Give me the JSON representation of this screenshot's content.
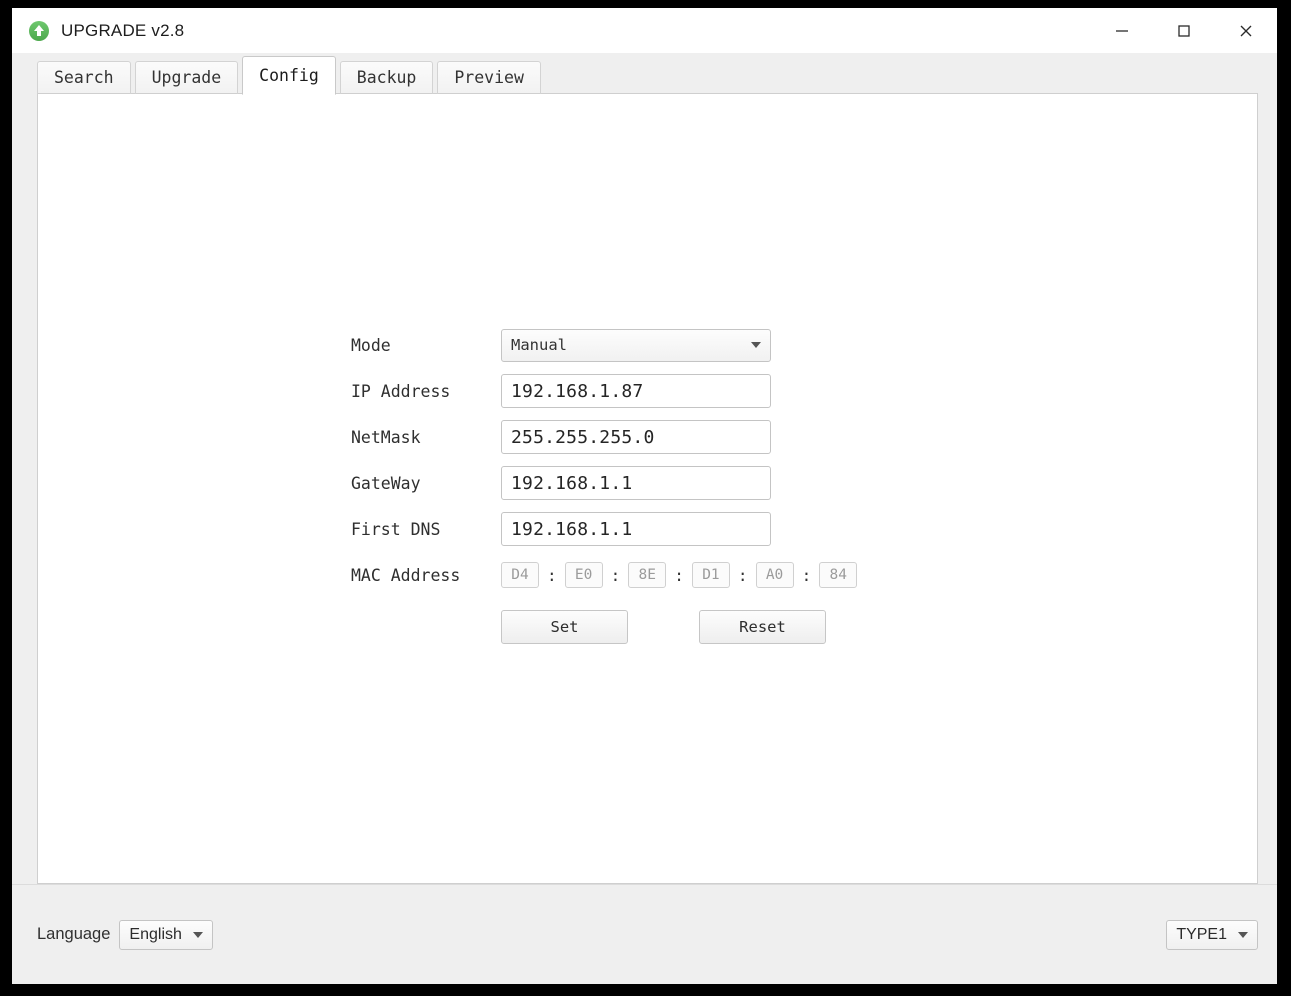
{
  "window": {
    "title": "UPGRADE v2.8",
    "app_icon": "upload-arrow-icon",
    "controls": {
      "minimize": "minimize-icon",
      "maximize": "maximize-icon",
      "close": "close-icon"
    }
  },
  "tabs": [
    {
      "label": "Search",
      "active": false
    },
    {
      "label": "Upgrade",
      "active": false
    },
    {
      "label": "Config",
      "active": true
    },
    {
      "label": "Backup",
      "active": false
    },
    {
      "label": "Preview",
      "active": false
    }
  ],
  "config_form": {
    "mode": {
      "label": "Mode",
      "value": "Manual"
    },
    "ip_address": {
      "label": "IP Address",
      "value": "192.168.1.87"
    },
    "netmask": {
      "label": "NetMask",
      "value": "255.255.255.0"
    },
    "gateway": {
      "label": "GateWay",
      "value": "192.168.1.1"
    },
    "first_dns": {
      "label": "First DNS",
      "value": "192.168.1.1"
    },
    "mac_address": {
      "label": "MAC Address",
      "separator": ":",
      "octets": [
        "D4",
        "E0",
        "8E",
        "D1",
        "A0",
        "84"
      ]
    },
    "buttons": {
      "set": "Set",
      "reset": "Reset"
    }
  },
  "status_bar": {
    "language_label": "Language",
    "language_value": "English",
    "type_value": "TYPE1"
  },
  "colors": {
    "accent_green": "#5cb85c",
    "window_bg": "#efefef",
    "panel_bg": "#ffffff",
    "border": "#cfcfcf",
    "disabled_text": "#9b9b9b"
  }
}
